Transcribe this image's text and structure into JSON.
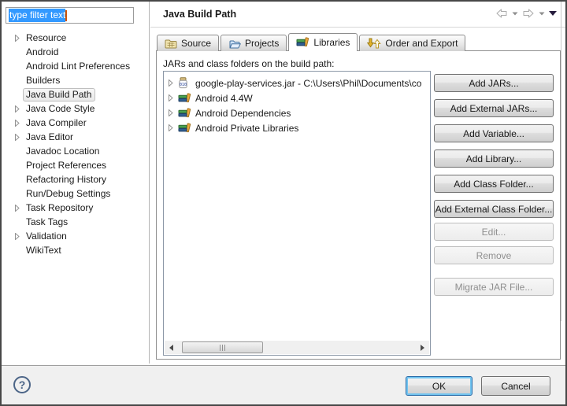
{
  "filter": {
    "value": "type filter text"
  },
  "sidebar": {
    "items": [
      {
        "label": "Resource",
        "expandable": true
      },
      {
        "label": "Android",
        "expandable": false
      },
      {
        "label": "Android Lint Preferences",
        "expandable": false
      },
      {
        "label": "Builders",
        "expandable": false
      },
      {
        "label": "Java Build Path",
        "expandable": false,
        "selected": true
      },
      {
        "label": "Java Code Style",
        "expandable": true
      },
      {
        "label": "Java Compiler",
        "expandable": true
      },
      {
        "label": "Java Editor",
        "expandable": true
      },
      {
        "label": "Javadoc Location",
        "expandable": false
      },
      {
        "label": "Project References",
        "expandable": false
      },
      {
        "label": "Refactoring History",
        "expandable": false
      },
      {
        "label": "Run/Debug Settings",
        "expandable": false
      },
      {
        "label": "Task Repository",
        "expandable": true
      },
      {
        "label": "Task Tags",
        "expandable": false
      },
      {
        "label": "Validation",
        "expandable": true
      },
      {
        "label": "WikiText",
        "expandable": false
      }
    ]
  },
  "header": {
    "title": "Java Build Path"
  },
  "tabs": [
    {
      "label": "Source",
      "icon": "package-folder-icon",
      "active": false
    },
    {
      "label": "Projects",
      "icon": "open-folder-icon",
      "active": false
    },
    {
      "label": "Libraries",
      "icon": "library-books-icon",
      "active": true
    },
    {
      "label": "Order and Export",
      "icon": "order-arrows-icon",
      "active": false
    }
  ],
  "panel": {
    "list_label": "JARs and class folders on the build path:",
    "items": [
      {
        "label": "google-play-services.jar - C:\\Users\\Phil\\Documents\\co",
        "icon": "jar-file-icon"
      },
      {
        "label": "Android 4.4W",
        "icon": "library-books-icon"
      },
      {
        "label": "Android Dependencies",
        "icon": "library-books-icon"
      },
      {
        "label": "Android Private Libraries",
        "icon": "library-books-icon"
      }
    ],
    "buttons": [
      {
        "label": "Add JARs...",
        "enabled": true
      },
      {
        "label": "Add External JARs...",
        "enabled": true
      },
      {
        "label": "Add Variable...",
        "enabled": true
      },
      {
        "label": "Add Library...",
        "enabled": true
      },
      {
        "label": "Add Class Folder...",
        "enabled": true
      },
      {
        "label": "Add External Class Folder...",
        "enabled": true
      },
      {
        "label": "Edit...",
        "enabled": false
      },
      {
        "label": "Remove",
        "enabled": false
      },
      {
        "label": "Migrate JAR File...",
        "enabled": false
      }
    ]
  },
  "footer": {
    "help": "?",
    "ok": "OK",
    "cancel": "Cancel"
  },
  "colors": {
    "selection_blue": "#3399ff",
    "caret_orange": "#d45500",
    "ok_focus_ring": "#71c3ef",
    "disabled_text": "#8f8f8f",
    "footer_bg": "#f0f0f0"
  }
}
